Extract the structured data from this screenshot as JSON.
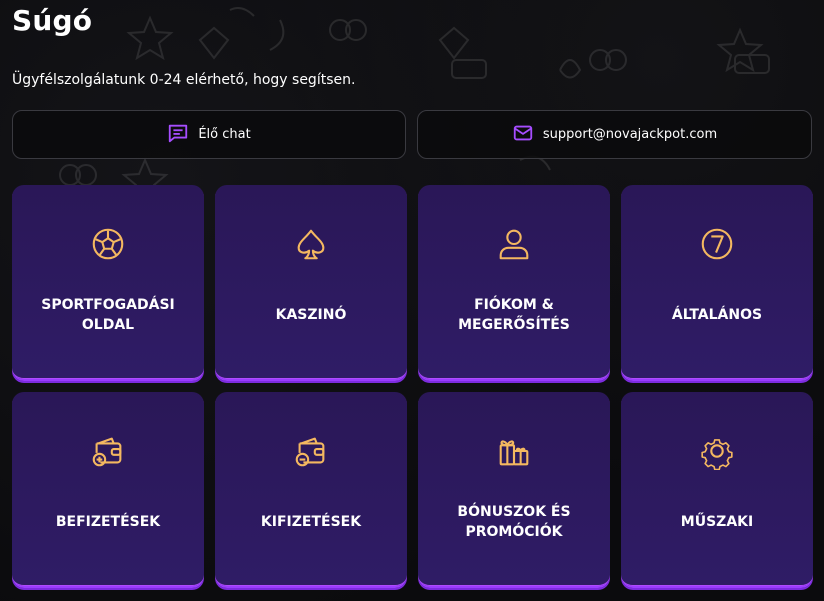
{
  "header": {
    "title": "Súgó",
    "subtitle": "Ügyfélszolgálatunk 0-24 elérhető, hogy segítsen."
  },
  "contact": {
    "chat_label": "Élő chat",
    "email_label": "support@novajackpot.com"
  },
  "categories": [
    {
      "label": "SPORTFOGADÁSI\nOLDAL",
      "icon": "soccer-ball-icon"
    },
    {
      "label": "KASZINÓ",
      "icon": "spade-icon"
    },
    {
      "label": "FIÓKOM &\nMEGERŐSÍTÉS",
      "icon": "user-icon"
    },
    {
      "label": "ÁLTALÁNOS",
      "icon": "number-seven-icon"
    },
    {
      "label": "BEFIZETÉSEK",
      "icon": "wallet-deposit-icon"
    },
    {
      "label": "KIFIZETÉSEK",
      "icon": "wallet-withdraw-icon"
    },
    {
      "label": "BÓNUSZOK ÉS\nPROMÓCIÓK",
      "icon": "gift-icon"
    },
    {
      "label": "MŰSZAKI",
      "icon": "gear-icon"
    }
  ],
  "colors": {
    "accent": "#9b3cff",
    "icon_gold": "#f4b860",
    "card_bg": "#2c1a60"
  }
}
